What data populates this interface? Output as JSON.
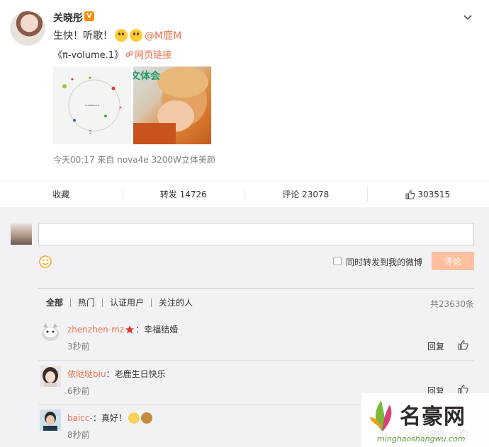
{
  "post": {
    "author_name": "关晓彤",
    "vip_badge": "V",
    "text_prefix": "生快！听歌！",
    "emoji_names": [
      "scared-face-emoji",
      "scared-face-emoji"
    ],
    "mention_at": "@M",
    "mention_name": "鹿M",
    "album_title": "《π-volume.1》",
    "link_label": "网页链接",
    "meta": "今天00:17 来自 nova4e 3200W立体美颜",
    "image1_caption": "π-volume.1",
    "image2_caption": "文体会"
  },
  "actions": {
    "favorite": "收藏",
    "repost": "转发 14726",
    "comment": "评论 23078",
    "like_count": "303515"
  },
  "compose": {
    "input_value": "",
    "repost_label": "同时转发到我的微博",
    "submit_label": "评论"
  },
  "filters": {
    "items": [
      "全部",
      "热门",
      "认证用户",
      "关注的人"
    ],
    "total": "共23630条"
  },
  "comments": [
    {
      "user": "zhenzhen-mz",
      "text": "：幸福结婚",
      "time": "3秒前",
      "reply": "回复"
    },
    {
      "user": "依哒哒biu",
      "text": "：老鹿生日快乐",
      "time": "6秒前",
      "reply": "回复"
    },
    {
      "user": "baicc-",
      "text": "：真好！",
      "time": "8秒前",
      "reply": "回复"
    }
  ],
  "watermark": {
    "title": "名豪网",
    "url": "minghaoshangwu.com"
  },
  "colors": {
    "accent": "#eb7350",
    "vip": "#f78d00",
    "submit_disabled": "#ffc09f",
    "comment_bg": "#f2f2f5"
  }
}
